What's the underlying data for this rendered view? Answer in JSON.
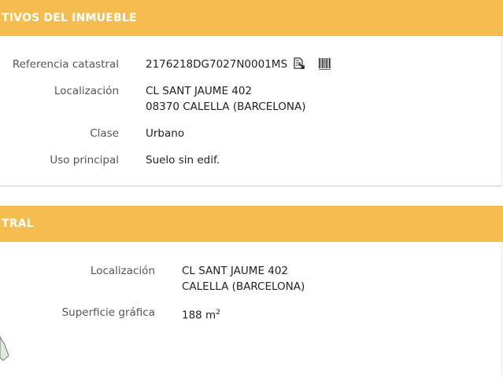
{
  "section1": {
    "title": "TIVOS DEL INMUEBLE",
    "rows": {
      "referencia": {
        "label": "Referencia catastral",
        "value": "2176218DG7027N0001MS"
      },
      "localizacion": {
        "label": "Localización",
        "line1": "CL SANT JAUME 402",
        "line2": "08370 CALELLA (BARCELONA)"
      },
      "clase": {
        "label": "Clase",
        "value": "Urbano"
      },
      "uso": {
        "label": "Uso principal",
        "value": "Suelo sin edif."
      }
    },
    "icons": [
      "copy-document-icon",
      "barcode-icon"
    ]
  },
  "section2": {
    "title": "TRAL",
    "rows": {
      "localizacion": {
        "label": "Localización",
        "line1": "CL SANT JAUME 402",
        "line2": "CALELLA (BARCELONA)"
      },
      "superficie": {
        "label": "Superficie gráfica",
        "value": "188 m",
        "unit_sup": "2"
      }
    }
  },
  "colors": {
    "banner": "#f5bd4f",
    "banner_text": "#ffffff",
    "label": "#555555",
    "value": "#222222"
  }
}
